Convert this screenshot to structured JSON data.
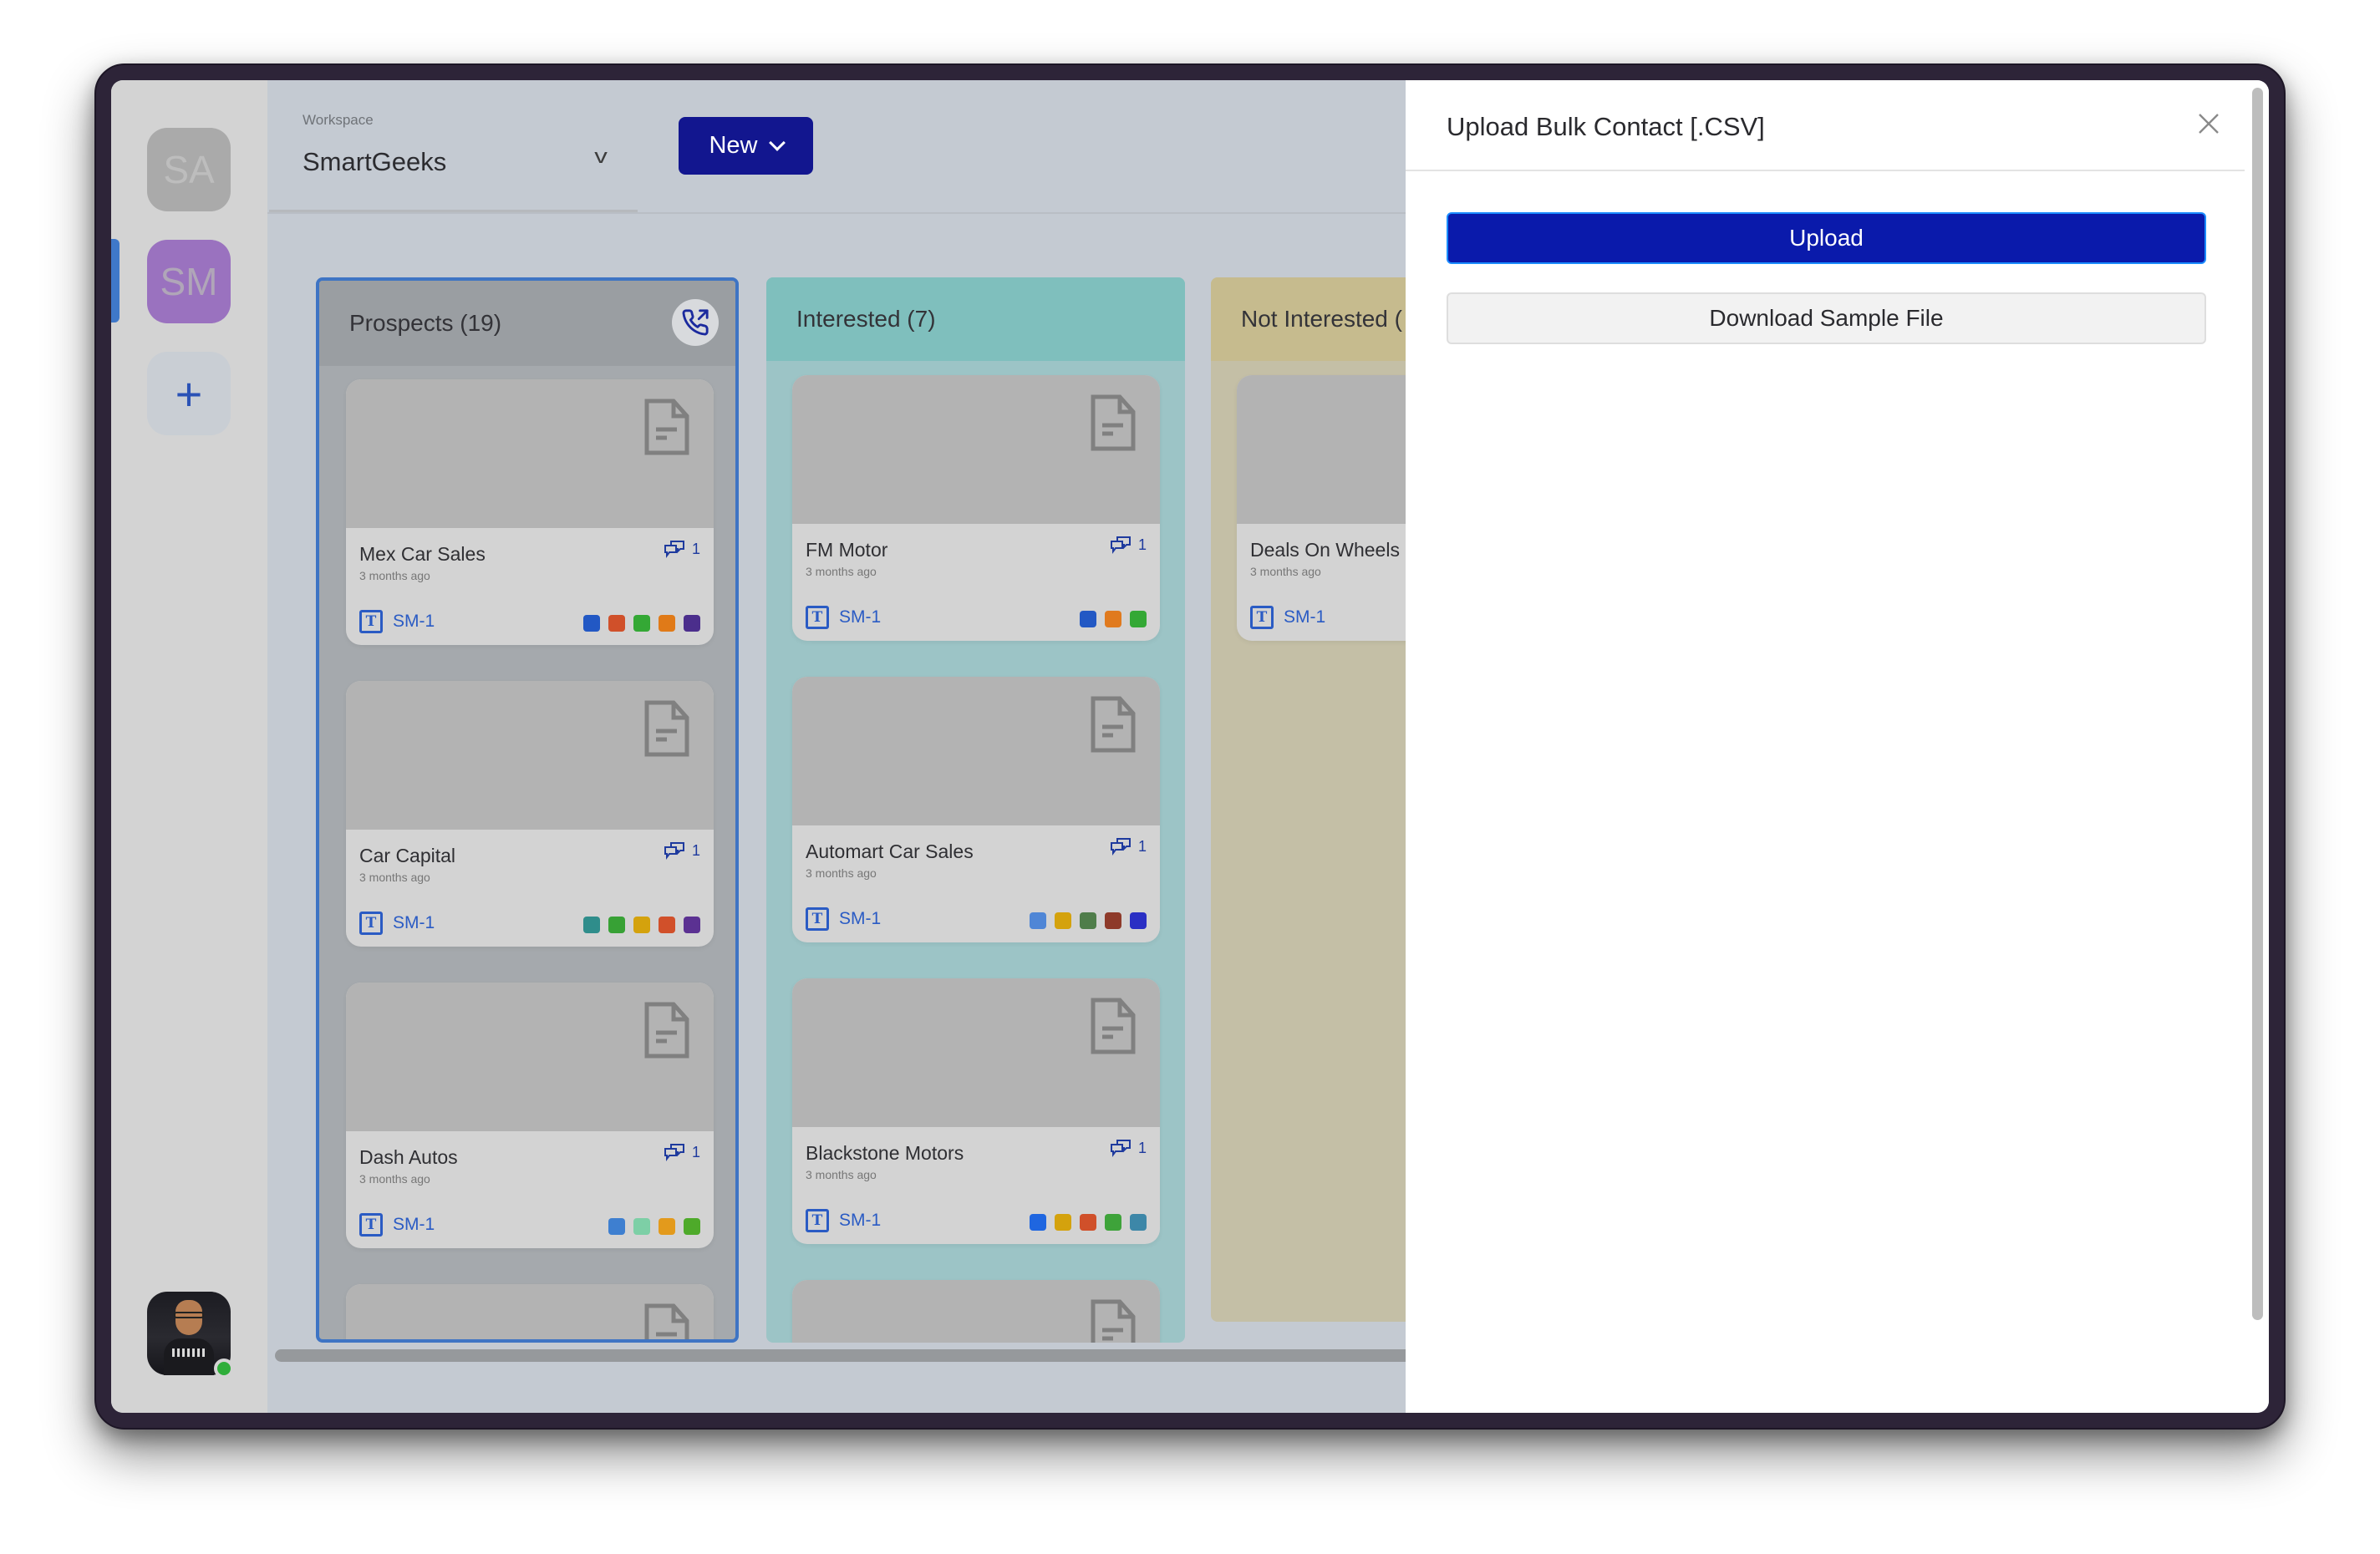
{
  "sidebar": {
    "workspaces": [
      {
        "initials": "SA",
        "active": false,
        "color": "#aaaaaa"
      },
      {
        "initials": "SM",
        "active": true,
        "color": "#9a72bf"
      }
    ],
    "add_label": "+",
    "profile": {
      "status": "online",
      "status_color": "#2fae3a"
    }
  },
  "header": {
    "workspace_label": "Workspace",
    "workspace_value": "SmartGeeks",
    "workspace_chevron": "v",
    "new_button_label": "New"
  },
  "board": {
    "columns": [
      {
        "name": "Prospects (19)",
        "color": "#9a9ea2",
        "has_call_action": true,
        "cards": [
          {
            "title": "Mex Car Sales",
            "time": "3 months ago",
            "comments": "1",
            "tag": "SM-1",
            "tag_icon": "T",
            "swatches": [
              "#2258c4",
              "#d0502a",
              "#34a835",
              "#e07a18",
              "#4b2e8c"
            ]
          },
          {
            "title": "Car Capital",
            "time": "3 months ago",
            "comments": "1",
            "tag": "SM-1",
            "tag_icon": "T",
            "swatches": [
              "#2f8d8b",
              "#37a135",
              "#d4a20d",
              "#d1502a",
              "#5b3192"
            ]
          },
          {
            "title": "Dash Autos",
            "time": "3 months ago",
            "comments": "1",
            "tag": "SM-1",
            "tag_icon": "T",
            "swatches": [
              "#3e7fd0",
              "#7dcfa6",
              "#e39a1c",
              "#4eaa2a"
            ]
          }
        ]
      },
      {
        "name": "Interested (7)",
        "color": "#7fbfbd",
        "has_call_action": false,
        "cards": [
          {
            "title": "FM Motor",
            "time": "3 months ago",
            "comments": "1",
            "tag": "SM-1",
            "tag_icon": "T",
            "swatches": [
              "#2258c4",
              "#e07a1e",
              "#34a835"
            ]
          },
          {
            "title": "Automart Car Sales",
            "time": "3 months ago",
            "comments": "1",
            "tag": "SM-1",
            "tag_icon": "T",
            "swatches": [
              "#4f86d6",
              "#d4a20d",
              "#4f7d4a",
              "#8e3a2a",
              "#2a2fc4"
            ]
          },
          {
            "title": "Blackstone Motors",
            "time": "3 months ago",
            "comments": "1",
            "tag": "SM-1",
            "tag_icon": "T",
            "swatches": [
              "#1f66e0",
              "#d4a20d",
              "#d0502a",
              "#3ea33a",
              "#3d87a8"
            ]
          }
        ]
      },
      {
        "name": "Not Interested (",
        "color": "#c6bb8e",
        "has_call_action": false,
        "cards": [
          {
            "title": "Deals On Wheels",
            "time": "3 months ago",
            "comments": "",
            "tag": "SM-1",
            "tag_icon": "T",
            "swatches": []
          }
        ]
      }
    ]
  },
  "drawer": {
    "title": "Upload Bulk Contact [.CSV]",
    "upload_label": "Upload",
    "download_label": "Download Sample File",
    "accent": "#0a1aab"
  }
}
